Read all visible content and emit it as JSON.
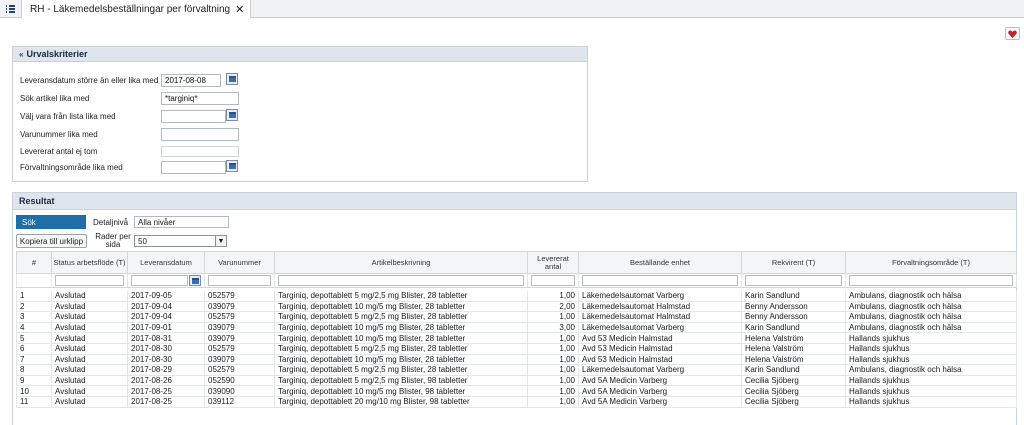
{
  "tab": {
    "title": "RH - Läkemedelsbeställningar per förvaltning",
    "close": "✕"
  },
  "criteria": {
    "title": "Urvalskriterier",
    "fields": [
      {
        "label": "Leveransdatum större än eller lika med",
        "value": "2017-08-08"
      },
      {
        "label": "Sök artikel lika med",
        "value": "*targiniq*"
      },
      {
        "label": "Välj vara från lista lika med",
        "value": ""
      },
      {
        "label": "Varunummer lika med",
        "value": ""
      },
      {
        "label": "Levererat antal ej tom",
        "value": ""
      },
      {
        "label": "Förvaltningsområde lika med",
        "value": ""
      }
    ]
  },
  "result": {
    "title": "Resultat",
    "search_button": "Sök",
    "copy_button": "Kopiera till urklipp",
    "detail_label": "Detaljnivå",
    "detail_value": "Alla nivåer",
    "rows_label": "Rader per sida",
    "rows_value": "50",
    "columns": [
      "#",
      "Status arbetsflöde (T)",
      "Leveransdatum",
      "Varunummer",
      "Artikelbeskrivning",
      "Levererat antal",
      "Beställande enhet",
      "Rekvirent (T)",
      "Förvaltningsområde (T)"
    ],
    "rows": [
      [
        "1",
        "Avslutad",
        "2017-09-05",
        "052579",
        "Targiniq, depottablett 5 mg/2,5 mg Blister, 28 tabletter",
        "1,00",
        "Läkemedelsautomat Varberg",
        "Karin Sandlund",
        "Ambulans, diagnostik och hälsa"
      ],
      [
        "2",
        "Avslutad",
        "2017-09-04",
        "039079",
        "Targiniq, depottablett 10 mg/5 mg Blister, 28 tabletter",
        "2,00",
        "Läkemedelsautomat Halmstad",
        "Benny Andersson",
        "Ambulans, diagnostik och hälsa"
      ],
      [
        "3",
        "Avslutad",
        "2017-09-04",
        "052579",
        "Targiniq, depottablett 5 mg/2,5 mg Blister, 28 tabletter",
        "1,00",
        "Läkemedelsautomat Halmstad",
        "Benny Andersson",
        "Ambulans, diagnostik och hälsa"
      ],
      [
        "4",
        "Avslutad",
        "2017-09-01",
        "039079",
        "Targiniq, depottablett 10 mg/5 mg Blister, 28 tabletter",
        "3,00",
        "Läkemedelsautomat Varberg",
        "Karin Sandlund",
        "Ambulans, diagnostik och hälsa"
      ],
      [
        "5",
        "Avslutad",
        "2017-08-31",
        "039079",
        "Targiniq, depottablett 10 mg/5 mg Blister, 28 tabletter",
        "1,00",
        "Avd 53 Medicin Halmstad",
        "Helena Valström",
        "Hallands sjukhus"
      ],
      [
        "6",
        "Avslutad",
        "2017-08-30",
        "052579",
        "Targiniq, depottablett 5 mg/2,5 mg Blister, 28 tabletter",
        "1,00",
        "Avd 53 Medicin Halmstad",
        "Helena Valström",
        "Hallands sjukhus"
      ],
      [
        "7",
        "Avslutad",
        "2017-08-30",
        "039079",
        "Targiniq, depottablett 10 mg/5 mg Blister, 28 tabletter",
        "1,00",
        "Avd 53 Medicin Halmstad",
        "Helena Valström",
        "Hallands sjukhus"
      ],
      [
        "8",
        "Avslutad",
        "2017-08-29",
        "052579",
        "Targiniq, depottablett 5 mg/2,5 mg Blister, 28 tabletter",
        "1,00",
        "Läkemedelsautomat Varberg",
        "Karin Sandlund",
        "Ambulans, diagnostik och hälsa"
      ],
      [
        "9",
        "Avslutad",
        "2017-08-26",
        "052590",
        "Targiniq, depottablett 5 mg/2,5 mg Blister, 98 tabletter",
        "1,00",
        "Avd 5A Medicin Varberg",
        "Cecilia Sjöberg",
        "Hallands sjukhus"
      ],
      [
        "10",
        "Avslutad",
        "2017-08-25",
        "039090",
        "Targiniq, depottablett 10 mg/5 mg Blister, 98 tabletter",
        "1,00",
        "Avd 5A Medicin Varberg",
        "Cecilia Sjöberg",
        "Hallands sjukhus"
      ],
      [
        "11",
        "Avslutad",
        "2017-08-25",
        "039112",
        "Targiniq, depottablett 20 mg/10 mg Blister, 98 tabletter",
        "1,00",
        "Avd 5A Medicin Varberg",
        "Cecilia Sjöberg",
        "Hallands sjukhus"
      ]
    ]
  },
  "colors": {
    "accent": "#1f6ea6",
    "panel_header": "#dfe5ec",
    "heart": "#c0262d"
  },
  "icons": {
    "menu": "menu-icon",
    "favorite": "heart-icon",
    "calendar": "calendar-icon",
    "collapse": "chevron-up-icon"
  }
}
